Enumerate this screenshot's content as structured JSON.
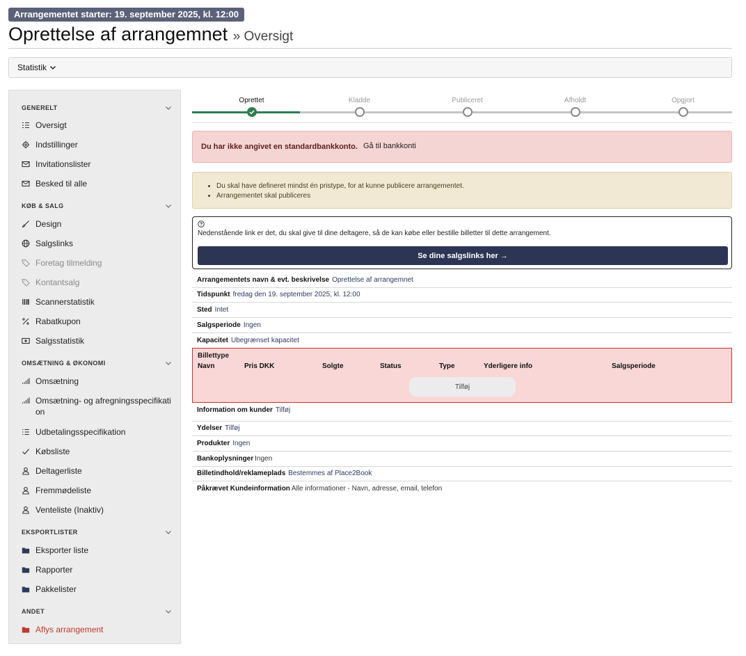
{
  "header": {
    "start_badge": "Arrangementet starter: 19. september 2025, kl. 12:00",
    "title": "Oprettelse af arrangemnet",
    "subtitle": "» Oversigt"
  },
  "statbar": {
    "label": "Statistik"
  },
  "sidebar": {
    "sections": [
      {
        "label": "GENERELT"
      },
      {
        "label": "KØB & SALG"
      },
      {
        "label": "OMSÆTNING & ØKONOMI"
      },
      {
        "label": "EKSPORTLISTER"
      },
      {
        "label": "ANDET"
      }
    ],
    "items": [
      {
        "label": "Oversigt",
        "icon": "list-icon"
      },
      {
        "label": "Indstillinger",
        "icon": "gear-icon"
      },
      {
        "label": "Invitationslister",
        "icon": "mail-icon"
      },
      {
        "label": "Besked til alle",
        "icon": "mail-icon"
      },
      {
        "label": "Design",
        "icon": "brush-icon"
      },
      {
        "label": "Salgslinks",
        "icon": "globe-icon"
      },
      {
        "label": "Foretag tilmelding",
        "icon": "tag-icon"
      },
      {
        "label": "Kontantsalg",
        "icon": "tag-icon"
      },
      {
        "label": "Scannerstatistik",
        "icon": "barcode-icon"
      },
      {
        "label": "Rabatkupon",
        "icon": "percent-icon"
      },
      {
        "label": "Salgsstatistik",
        "icon": "cash-icon"
      },
      {
        "label": "Omsætning",
        "icon": "signal-icon"
      },
      {
        "label": "Omsætning- og afregningsspecifikati on",
        "icon": "signal-icon"
      },
      {
        "label": "Udbetalingsspecifikation",
        "icon": "list-icon"
      },
      {
        "label": "Købsliste",
        "icon": "check-icon"
      },
      {
        "label": "Deltagerliste",
        "icon": "user-icon"
      },
      {
        "label": "Fremmødeliste",
        "icon": "user-icon"
      },
      {
        "label": "Venteliste (Inaktiv)",
        "icon": "user-icon"
      },
      {
        "label": "Eksporter liste",
        "icon": "folder-icon"
      },
      {
        "label": "Rapporter",
        "icon": "folder-icon"
      },
      {
        "label": "Pakkelister",
        "icon": "folder-icon"
      },
      {
        "label": "Aflys arrangement",
        "icon": "folder-icon"
      }
    ]
  },
  "steps": [
    {
      "label": "Oprettet",
      "done": true
    },
    {
      "label": "Kladde",
      "done": false
    },
    {
      "label": "Publiceret",
      "done": false
    },
    {
      "label": "Afholdt",
      "done": false
    },
    {
      "label": "Opgjort",
      "done": false
    }
  ],
  "alerts": {
    "bank_missing": "Du har ikke angivet en standardbankkonto.",
    "bank_link": "Gå til bankkonti",
    "warnings": [
      "Du skal have defineret mindst én pristype, for at kunne publicere arrangementet.",
      "Arrangementet skal publiceres"
    ]
  },
  "info": {
    "text": "Nedenstående link er det, du skal give til dine deltagere, så de kan købe eller bestille billetter til dette arrangement.",
    "button": "Se dine salgslinks her →"
  },
  "details": {
    "name_k": "Arrangementets navn & evt. beskrivelse",
    "name_v": "Oprettelse af arrangemnet",
    "time_k": "Tidspunkt",
    "time_v": "fredag den 19. september 2025, kl. 12:00",
    "place_k": "Sted",
    "place_v": "Intet",
    "period_k": "Salgsperiode",
    "period_v": "Ingen",
    "cap_k": "Kapacitet",
    "cap_v": "Ubegrænset kapacitet",
    "cust_k": "Information om kunder",
    "cust_v": "Tilføj",
    "serv_k": "Ydelser",
    "serv_v": "Tilføj",
    "prod_k": "Produkter",
    "prod_v": "Ingen",
    "bank_k": "Bankoplysninger",
    "bank_v": "Ingen",
    "tickc_k": "Billetindhold/reklameplads",
    "tickc_v": "Bestemmes af Place2Book",
    "req_k": "Påkrævet Kundeinformation",
    "req_v": "Alle informationer - Navn, adresse, email, telefon"
  },
  "ticket": {
    "title": "Billettype",
    "columns": [
      "Navn",
      "Pris DKK",
      "Solgte",
      "Status",
      "Type",
      "Yderligere info",
      "Salgsperiode"
    ],
    "add": "Tilføj"
  }
}
